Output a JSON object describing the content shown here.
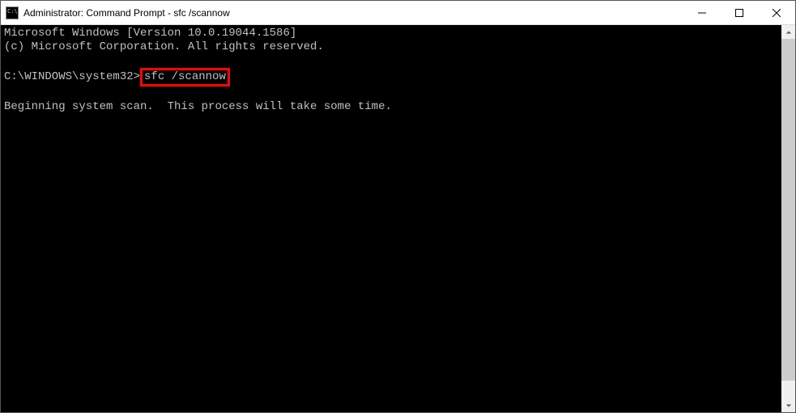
{
  "window": {
    "title": "Administrator: Command Prompt - sfc  /scannow"
  },
  "terminal": {
    "line1": "Microsoft Windows [Version 10.0.19044.1586]",
    "line2": "(c) Microsoft Corporation. All rights reserved.",
    "prompt": "C:\\WINDOWS\\system32>",
    "command": "sfc /scannow",
    "status": "Beginning system scan.  This process will take some time."
  }
}
